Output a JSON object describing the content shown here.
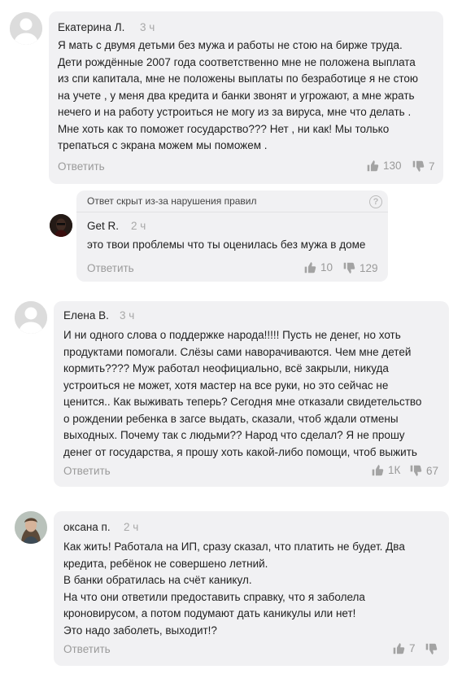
{
  "comments": [
    {
      "author": "Екатерина Л.",
      "time": "3 ч",
      "lines": [
        "Я мать с двумя детьми без мужа и работы не стою на бирже труда.",
        "Дети рождённые 2007 года соответственно мне не положена выплата",
        "из спи капитала, мне не положены выплаты по безработице я не стою",
        "на учете , у меня два кредита и банки звонят и угрожают, а мне жрать",
        "нечего и на работу устроиться не могу из за вируса, мне что делать .",
        "Мне хоть как то поможет государство??? Нет , ни как! Мы только",
        "трепаться с экрана можем мы поможем ."
      ],
      "reply_label": "Ответить",
      "likes": "130",
      "dislikes": "7"
    },
    {
      "hidden_notice": "Ответ скрыт из-за нарушения правил",
      "help_glyph": "?",
      "author": "Get R.",
      "time": "2 ч",
      "lines": [
        "это твои проблемы что ты оценилась без мужа в доме"
      ],
      "reply_label": "Ответить",
      "likes": "10",
      "dislikes": "129"
    },
    {
      "author": "Елена В.",
      "time": "3 ч",
      "lines": [
        "И ни одного слова о поддержке народа!!!!! Пусть не денег,  но хоть",
        "продуктами помогали. Слёзы сами наворачиваются. Чем мне детей",
        "кормить???? Муж работал неофициально, всё закрыли, никуда",
        "устроиться не может, хотя мастер на все руки, но это сейчас не",
        "ценится.. Как выживать теперь? Сегодня мне отказали свидетельство",
        "о рождении ребенка в загсе выдать,  сказали, чтоб ждали отмены",
        "выходных. Почему так с людьми?? Народ что сделал? Я не прошу",
        "денег от государства, я прошу хоть какой-либо помощи, чтоб выжить"
      ],
      "reply_label": "Ответить",
      "likes": "1К",
      "dislikes": "67"
    },
    {
      "author": "оксана п.",
      "time": "2 ч",
      "lines": [
        "Как жить! Работала  на ИП, сразу сказал, что  платить не будет. Два",
        "кредита, ребёнок  не совершено летний.",
        "В банки  обратилась на счёт каникул.",
        "На что они ответили предоставить справку, что я заболела",
        "кроновирусом, а потом подумают дать каникулы или нет!",
        "Это надо заболеть, выходит!?"
      ],
      "reply_label": "Ответить",
      "likes": "7"
    }
  ],
  "icons": {
    "like": "thumbs-up-icon",
    "dislike": "thumbs-down-icon"
  },
  "colors": {
    "bubble": "#f1f1f3",
    "muted_text": "#9a9a9a",
    "time_text": "#a8a8a8"
  }
}
